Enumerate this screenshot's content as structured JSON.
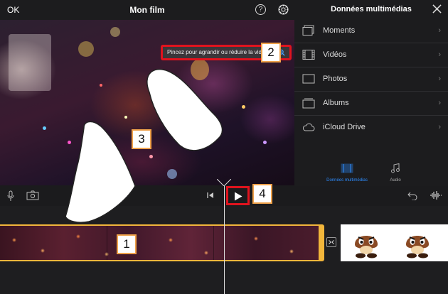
{
  "topbar": {
    "ok_label": "OK",
    "title": "Mon film",
    "help_label": "?"
  },
  "preview": {
    "hint": "Pincez pour agrandir ou réduire la vidéo."
  },
  "panel": {
    "title": "Données multimédias",
    "items": [
      {
        "label": "Moments",
        "icon": "moments-icon"
      },
      {
        "label": "Vidéos",
        "icon": "film-icon"
      },
      {
        "label": "Photos",
        "icon": "photo-icon"
      },
      {
        "label": "Albums",
        "icon": "album-icon"
      },
      {
        "label": "iCloud Drive",
        "icon": "cloud-icon"
      }
    ],
    "tabs": [
      {
        "label": "Données multimédias",
        "active": true
      },
      {
        "label": "Audio",
        "active": false
      }
    ],
    "accent_color": "#2d8cff"
  },
  "badges": {
    "clip": "1",
    "hint": "2",
    "pinch": "3",
    "play": "4"
  },
  "colors": {
    "highlight": "#e0131e",
    "clip_border": "#f2b63b",
    "badge_border": "#f0a24a"
  }
}
